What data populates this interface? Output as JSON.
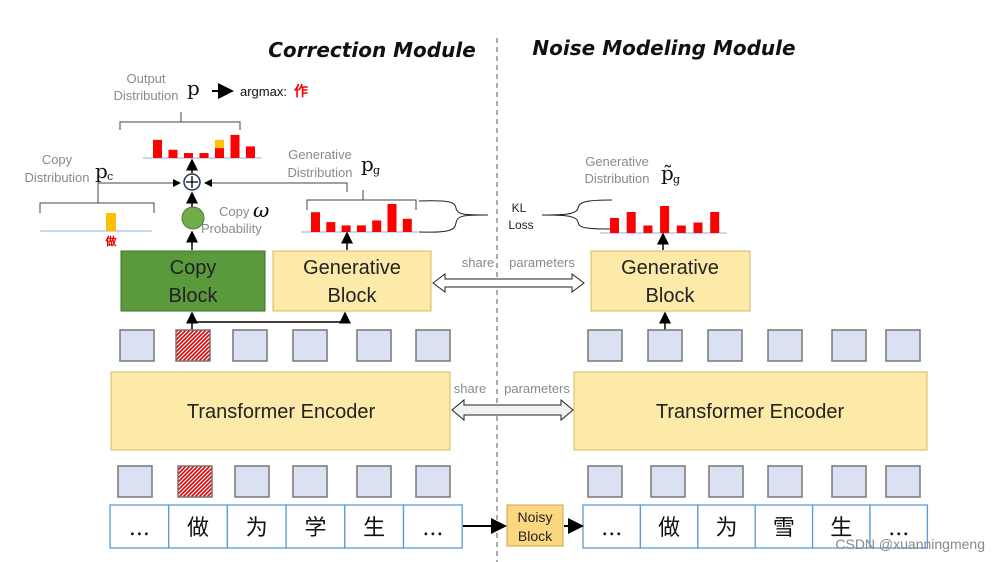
{
  "titles": {
    "correction": "Correction Module",
    "noise": "Noise Modeling Module"
  },
  "output": {
    "label1": "Output",
    "label2": "Distribution",
    "symbol": "p",
    "argmax": "argmax:",
    "argmax_char": "作"
  },
  "copy_dist": {
    "label1": "Copy",
    "label2": "Distribution",
    "symbol": "p",
    "sub": "c",
    "char": "做"
  },
  "gen_dist": {
    "label1": "Generative",
    "label2": "Distribution",
    "symbol": "p",
    "sub": "g"
  },
  "noise_gen_dist": {
    "label1": "Generative",
    "label2": "Distribution",
    "symbol": "p̃",
    "sub": "g"
  },
  "copy_prob": {
    "label1": "Copy",
    "label2": "Probability",
    "symbol": "ω"
  },
  "kl": {
    "line1": "KL",
    "line2": "Loss"
  },
  "blocks": {
    "copy1": "Copy",
    "copy2": "Block",
    "gen1": "Generative",
    "gen2": "Block",
    "encoder": "Transformer Encoder",
    "noisy1": "Noisy",
    "noisy2": "Block"
  },
  "share": {
    "word": "share",
    "params": "parameters"
  },
  "tokens_left": [
    "...",
    "做",
    "为",
    "学",
    "生",
    "..."
  ],
  "tokens_right": [
    "...",
    "做",
    "为",
    "雪",
    "生",
    "..."
  ],
  "watermark": "CSDN @xuanningmeng",
  "histograms": {
    "output": [
      0.55,
      0.25,
      0.15,
      0.15,
      0.3,
      0.7,
      0.35
    ],
    "output_copy_part": [
      0,
      0,
      0,
      0,
      0.25,
      0,
      0
    ],
    "generative": [
      0.6,
      0.3,
      0.2,
      0.2,
      0.35,
      0.85,
      0.4
    ],
    "noise_generative": [
      0.5,
      0.7,
      0.25,
      0.9,
      0.25,
      0.35,
      0.7
    ]
  },
  "colors": {
    "bar": "#ff0000",
    "copy_bar": "#ffc000",
    "copy_block": "#5b9a3c",
    "yellow_block": "#fde9a8",
    "token_red": "#ff0000",
    "embedding": "#d9e1f2"
  }
}
